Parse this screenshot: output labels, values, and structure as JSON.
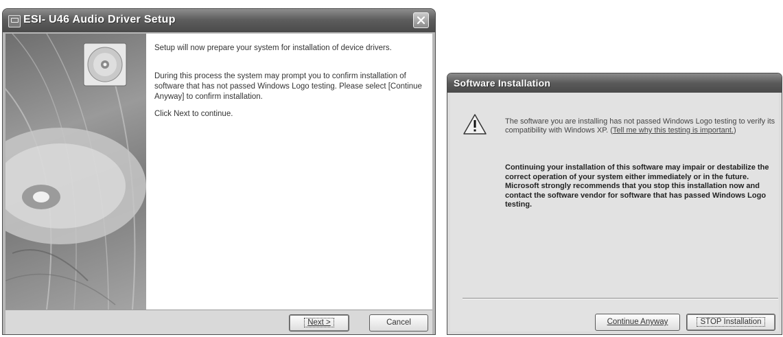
{
  "setup_window": {
    "title": "ESI- U46 Audio Driver Setup",
    "content": {
      "paragraph1": "Setup will now prepare your system for installation of device drivers.",
      "paragraph2": "During this process the system may prompt you to confirm installation of software that has not passed Windows Logo testing. Please select [Continue Anyway] to confirm installation.",
      "paragraph3": "Click Next to continue."
    },
    "buttons": {
      "next_label": "Next >",
      "cancel_label": "Cancel"
    }
  },
  "software_install_window": {
    "title": "Software Installation",
    "message_lead": "The software you are installing has not passed Windows Logo testing to verify its compatibility with Windows XP. (",
    "message_link": "Tell me why this testing is important.",
    "message_tail": ")",
    "warning": "Continuing your installation of this software may impair or destabilize the correct operation of your system either immediately or in the future. Microsoft strongly recommends that you stop this installation now and contact the software vendor for software that has passed Windows Logo testing.",
    "buttons": {
      "continue_label": "Continue Anyway",
      "stop_label": "STOP Installation"
    }
  },
  "icons": {
    "app_icon": "setup-app-icon",
    "close_icon": "close-x-icon",
    "cd_icon": "cd-disc-icon",
    "warning_icon": "exclamation-warning-icon"
  }
}
